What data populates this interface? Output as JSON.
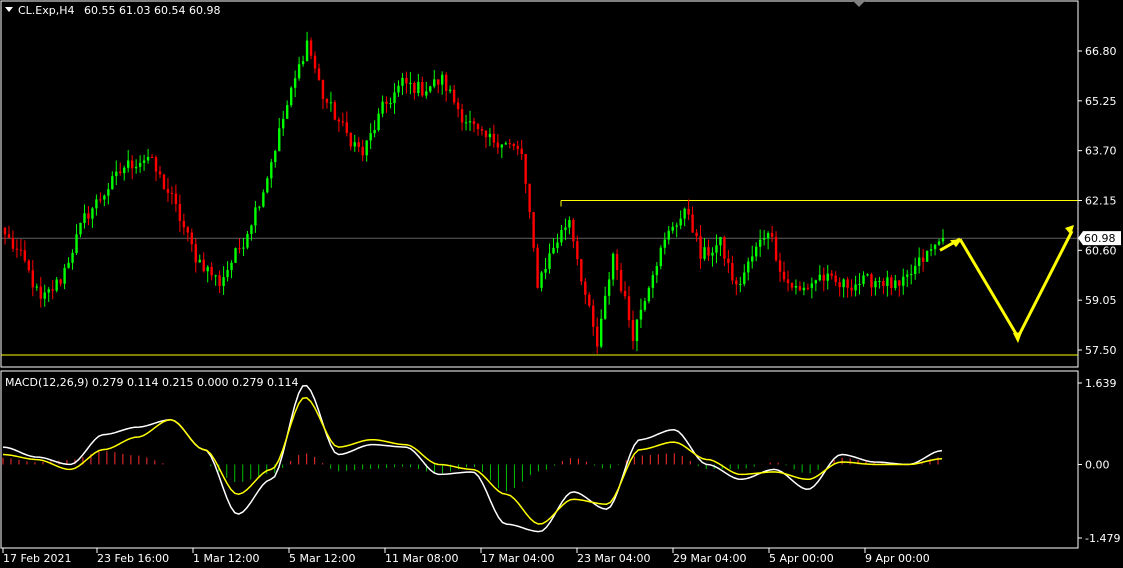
{
  "header": {
    "symbol_text": "CL.Exp,H4",
    "ohlc_text": "60.55 61.03 60.54 60.98"
  },
  "colors": {
    "background": "#000000",
    "bull_candle": "#00ff00",
    "bear_candle": "#ff0000",
    "line_white": "#ffffff",
    "signal_yellow": "#ffff00",
    "level_lines": "#ffff00",
    "price_line": "#c0c0c0",
    "hist_up": "#ff3030",
    "hist_down": "#00c000"
  },
  "chart_data": [
    {
      "type": "candlestick",
      "ylim": [
        57.5,
        66.8
      ],
      "y_ticks": [
        "66.80",
        "65.25",
        "63.70",
        "62.15",
        "60.60",
        "59.05",
        "57.50"
      ],
      "current_price_label": "60.98",
      "current_price": 60.98,
      "resistance_level": 62.15,
      "support_level": 57.5,
      "x_tick_labels": [
        "17 Feb 2021",
        "23 Feb 16:00",
        "1 Mar 12:00",
        "5 Mar 12:00",
        "11 Mar 08:00",
        "17 Mar 04:00",
        "23 Mar 04:00",
        "29 Mar 04:00",
        "5 Apr 00:00",
        "9 Apr 00:00"
      ],
      "price_anchors": [
        {
          "i": 0,
          "p": 61.1
        },
        {
          "i": 5,
          "p": 60.2
        },
        {
          "i": 9,
          "p": 59.0
        },
        {
          "i": 14,
          "p": 59.7
        },
        {
          "i": 20,
          "p": 61.6
        },
        {
          "i": 30,
          "p": 63.2
        },
        {
          "i": 36,
          "p": 63.5
        },
        {
          "i": 42,
          "p": 62.2
        },
        {
          "i": 48,
          "p": 60.4
        },
        {
          "i": 54,
          "p": 59.6
        },
        {
          "i": 60,
          "p": 60.9
        },
        {
          "i": 65,
          "p": 62.5
        },
        {
          "i": 70,
          "p": 64.7
        },
        {
          "i": 76,
          "p": 67.1
        },
        {
          "i": 80,
          "p": 65.4
        },
        {
          "i": 86,
          "p": 64.2
        },
        {
          "i": 90,
          "p": 63.6
        },
        {
          "i": 95,
          "p": 65.0
        },
        {
          "i": 100,
          "p": 65.8
        },
        {
          "i": 105,
          "p": 65.6
        },
        {
          "i": 110,
          "p": 65.9
        },
        {
          "i": 115,
          "p": 64.8
        },
        {
          "i": 120,
          "p": 64.1
        },
        {
          "i": 125,
          "p": 64.0
        },
        {
          "i": 130,
          "p": 63.6
        },
        {
          "i": 134,
          "p": 59.6
        },
        {
          "i": 138,
          "p": 60.7
        },
        {
          "i": 142,
          "p": 61.6
        },
        {
          "i": 146,
          "p": 59.2
        },
        {
          "i": 149,
          "p": 57.6
        },
        {
          "i": 153,
          "p": 60.5
        },
        {
          "i": 158,
          "p": 58.0
        },
        {
          "i": 163,
          "p": 60.0
        },
        {
          "i": 168,
          "p": 61.4
        },
        {
          "i": 172,
          "p": 61.8
        },
        {
          "i": 175,
          "p": 60.4
        },
        {
          "i": 180,
          "p": 60.8
        },
        {
          "i": 184,
          "p": 59.4
        },
        {
          "i": 188,
          "p": 60.4
        },
        {
          "i": 192,
          "p": 61.3
        },
        {
          "i": 196,
          "p": 59.7
        },
        {
          "i": 200,
          "p": 59.3
        },
        {
          "i": 205,
          "p": 59.8
        },
        {
          "i": 210,
          "p": 59.5
        },
        {
          "i": 215,
          "p": 59.6
        },
        {
          "i": 220,
          "p": 59.7
        },
        {
          "i": 225,
          "p": 59.4
        },
        {
          "i": 230,
          "p": 60.2
        },
        {
          "i": 236,
          "p": 60.98
        }
      ],
      "forecast_path": [
        60.95,
        57.9,
        61.2
      ]
    },
    {
      "type": "line",
      "title": "MACD(12,26,9) 0.279 0.114 0.215 0.000 0.279 0.114",
      "ylim": [
        -1.479,
        1.639
      ],
      "y_ticks": [
        "1.639",
        "0.00",
        "-1.479"
      ],
      "main_line": [
        0.35,
        0.15,
        0.0,
        0.6,
        0.75,
        0.9,
        0.3,
        -1.0,
        -0.3,
        1.6,
        0.2,
        0.4,
        0.35,
        -0.2,
        -0.15,
        -1.2,
        -1.35,
        -0.55,
        -0.9,
        0.5,
        0.7,
        0.0,
        -0.3,
        -0.1,
        -0.5,
        0.2,
        0.05,
        0.0,
        0.279
      ],
      "signal_line": [
        0.2,
        0.1,
        -0.1,
        0.3,
        0.55,
        0.9,
        0.3,
        -0.6,
        -0.1,
        1.35,
        0.35,
        0.5,
        0.4,
        0.0,
        -0.1,
        -0.6,
        -1.2,
        -0.7,
        -0.8,
        0.3,
        0.45,
        0.1,
        -0.2,
        -0.15,
        -0.3,
        0.05,
        0.0,
        0.0,
        0.114
      ]
    }
  ]
}
